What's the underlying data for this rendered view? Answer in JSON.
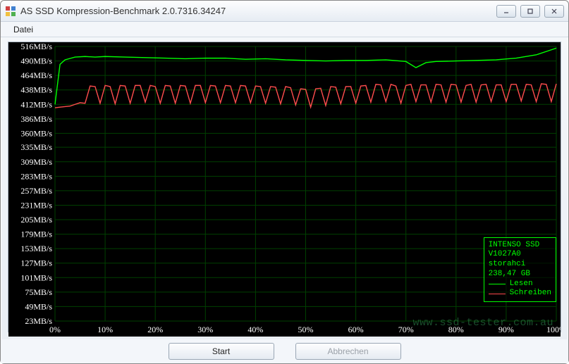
{
  "window": {
    "title": "AS SSD Kompression-Benchmark 2.0.7316.34247"
  },
  "menubar": {
    "items": [
      "Datei"
    ]
  },
  "buttons": {
    "start": "Start",
    "cancel": "Abbrechen"
  },
  "info_panel": {
    "lines": [
      "INTENSO SSD",
      "V1027A0",
      "storahci",
      "238,47 GB"
    ],
    "legend": [
      {
        "color": "#00ff00",
        "label": "Lesen"
      },
      {
        "color": "#ff4d4d",
        "label": "Schreiben"
      }
    ]
  },
  "watermark": "www.ssd-tester.com.au",
  "chart_data": {
    "type": "line",
    "title": "",
    "xlabel": "",
    "ylabel": "",
    "xlim": [
      0,
      100
    ],
    "ylim": [
      23,
      516
    ],
    "x_unit": "%",
    "y_unit": "MB/s",
    "y_ticks": [
      516,
      490,
      464,
      438,
      412,
      386,
      360,
      335,
      309,
      283,
      257,
      231,
      205,
      179,
      153,
      127,
      101,
      75,
      49,
      23
    ],
    "x_ticks": [
      0,
      10,
      20,
      30,
      40,
      50,
      60,
      70,
      80,
      90,
      100
    ],
    "series": [
      {
        "name": "Lesen",
        "color": "#00ff00",
        "x": [
          0,
          1,
          2,
          4,
          6,
          8,
          10,
          14,
          18,
          22,
          26,
          30,
          34,
          38,
          42,
          46,
          50,
          54,
          58,
          62,
          66,
          70,
          72,
          74,
          76,
          80,
          84,
          88,
          92,
          96,
          100
        ],
        "values": [
          412,
          484,
          492,
          497,
          498,
          497,
          498,
          497,
          496,
          495,
          494,
          495,
          495,
          493,
          494,
          492,
          491,
          490,
          491,
          491,
          492,
          489,
          478,
          487,
          489,
          490,
          491,
          492,
          495,
          501,
          513
        ]
      },
      {
        "name": "Schreiben",
        "color": "#ff4d4d",
        "x": [
          0,
          1,
          2,
          3,
          4,
          5,
          6,
          7,
          8,
          9,
          10,
          11,
          12,
          13,
          14,
          15,
          16,
          17,
          18,
          19,
          20,
          21,
          22,
          23,
          24,
          25,
          26,
          27,
          28,
          29,
          30,
          31,
          32,
          33,
          34,
          35,
          36,
          37,
          38,
          39,
          40,
          41,
          42,
          43,
          44,
          45,
          46,
          47,
          48,
          49,
          50,
          51,
          52,
          53,
          54,
          55,
          56,
          57,
          58,
          59,
          60,
          61,
          62,
          63,
          64,
          65,
          66,
          67,
          68,
          69,
          70,
          71,
          72,
          73,
          74,
          75,
          76,
          77,
          78,
          79,
          80,
          81,
          82,
          83,
          84,
          85,
          86,
          87,
          88,
          89,
          90,
          91,
          92,
          93,
          94,
          95,
          96,
          97,
          98,
          99,
          100
        ],
        "values": [
          406,
          407,
          408,
          409,
          412,
          415,
          414,
          445,
          444,
          414,
          446,
          444,
          413,
          446,
          445,
          414,
          446,
          446,
          416,
          446,
          444,
          414,
          446,
          445,
          414,
          446,
          445,
          414,
          446,
          446,
          415,
          446,
          445,
          415,
          446,
          445,
          415,
          446,
          445,
          415,
          445,
          444,
          414,
          444,
          443,
          413,
          444,
          442,
          411,
          440,
          439,
          407,
          440,
          441,
          410,
          444,
          443,
          413,
          444,
          444,
          414,
          445,
          446,
          416,
          448,
          447,
          417,
          448,
          445,
          414,
          446,
          448,
          417,
          447,
          447,
          416,
          448,
          447,
          416,
          448,
          447,
          416,
          446,
          448,
          416,
          447,
          448,
          417,
          447,
          447,
          417,
          448,
          448,
          418,
          448,
          447,
          417,
          449,
          448,
          417,
          449
        ]
      }
    ]
  }
}
